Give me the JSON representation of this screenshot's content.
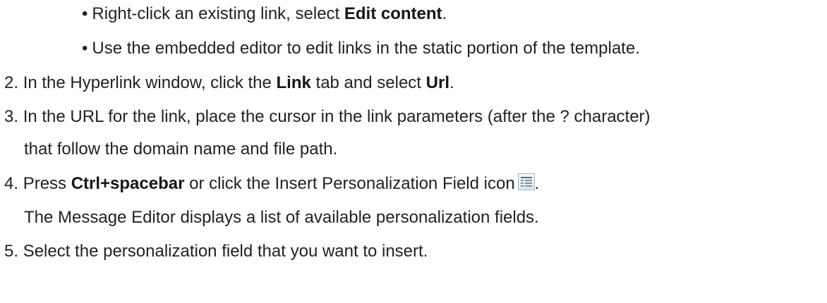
{
  "sub_items": [
    {
      "bullet": "•",
      "pre": "Right-click an existing link, select ",
      "bold": "Edit content",
      "post": "."
    },
    {
      "bullet": "•",
      "text": "Use the embedded editor to edit links in the static portion of the template."
    }
  ],
  "steps": [
    {
      "num": "2.",
      "pre": "In the Hyperlink window, click the ",
      "bold1": "Link",
      "mid": " tab and select ",
      "bold2": "Url",
      "post": "."
    },
    {
      "num": "3.",
      "line1": "In the URL for the link, place the cursor in the link parameters (after the ? character)",
      "line2": "that follow the domain name and file path."
    },
    {
      "num": "4.",
      "pre": "Press ",
      "bold": "Ctrl+spacebar",
      "post": " or click the Insert Personalization Field icon",
      "icon": "insert-personalization-field-icon",
      "after_icon": ".",
      "note": "The Message Editor displays a list of available personalization fields."
    },
    {
      "num": "5.",
      "text": "Select the personalization field that you want to insert."
    }
  ]
}
